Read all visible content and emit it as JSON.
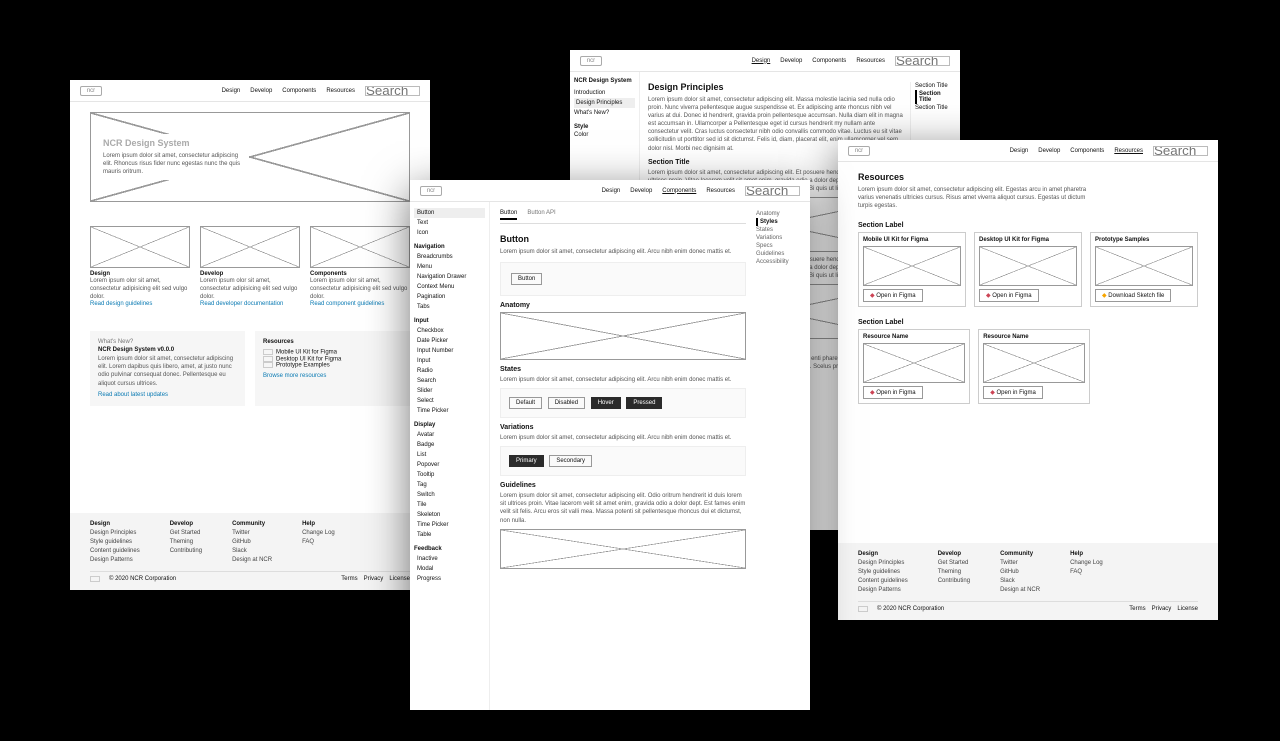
{
  "nav": [
    "Design",
    "Develop",
    "Components",
    "Resources"
  ],
  "search_ph": "Search",
  "p1": {
    "hero_title": "NCR Design System",
    "hero_sub": "Lorem ipsum dolor sit amet, consectetur adipiscing elit. Rhoncus risus fider nunc egestas nunc the quis mauris oritrum.",
    "cards": [
      {
        "title": "Design",
        "sub": "Lorem ipsum olor sit amet, consectetur adipisicing elit sed vulgo dolor.",
        "link": "Read design guidelines"
      },
      {
        "title": "Develop",
        "sub": "Lorem ipsum olor sit amet, consectetur adipisicing elit sed vulgo dolor.",
        "link": "Read developer documentation"
      },
      {
        "title": "Components",
        "sub": "Lorem ipsum olor sit amet, consectetur adipisicing elit sed vulgo dolor.",
        "link": "Read component guidelines"
      }
    ],
    "whatsnew_label": "What's New?",
    "whatsnew_title": "NCR Design System v0.0.0",
    "whatsnew_body": "Lorem ipsum dolor sit amet, consectetur adipiscing elit. Lorem dapibus quis libero, amet, at justo nunc odio pulvinar consequat donec. Pellentesque eu aliquot cursus ultrices.",
    "whatsnew_link": "Read about latest updates",
    "resources_title": "Resources",
    "resources": [
      "Mobile UI Kit for Figma",
      "Desktop UI Kit for Figma",
      "Prototype Examples"
    ],
    "resources_link": "Browse more resources"
  },
  "p2": {
    "sidebar": {
      "groups": [
        {
          "name": "",
          "items": [
            "Button",
            "Text",
            "Icon"
          ]
        },
        {
          "name": "Navigation",
          "items": [
            "Breadcrumbs",
            "Menu",
            "Navigation Drawer",
            "Context Menu",
            "Pagination",
            "Tabs"
          ]
        },
        {
          "name": "Input",
          "items": [
            "Checkbox",
            "Date Picker",
            "Input Number",
            "Input",
            "Radio",
            "Search",
            "Slider",
            "Select",
            "Time Picker"
          ]
        },
        {
          "name": "Display",
          "items": [
            "Avatar",
            "Badge",
            "List",
            "Popover",
            "Tooltip",
            "Tag",
            "Switch",
            "Tile",
            "Skeleton",
            "Time Picker",
            "Table"
          ]
        },
        {
          "name": "Feedback",
          "items": [
            "Inactive",
            "Modal",
            "Progress"
          ]
        }
      ],
      "active": "Button"
    },
    "tabs": [
      "Button",
      "Button API"
    ],
    "toc": [
      "Anatomy",
      "Styles",
      "States",
      "Variations",
      "Specs",
      "Guidelines",
      "Accessibility"
    ],
    "sections": {
      "title": "Button",
      "intro": "Lorem ipsum dolor sit amet, consectetur adipiscing elit. Arcu nibh enim donec mattis et.",
      "anatomy": "Anatomy",
      "states": "States",
      "states_btns": [
        "Default",
        "Disabled",
        "Hover",
        "Pressed"
      ],
      "variations": "Variations",
      "var_btns": [
        "Primary",
        "Secondary"
      ],
      "guidelines": "Guidelines",
      "guidelines_body": "Lorem ipsum dolor sit amet, consectetur adipiscing elit. Odio oritrum hendrerit id duis lorem sit ultrices proin. Vitae lacerom velit sit amet enim, gravida odio a dolor dept. Est fames enim velit sit felis. Arcu eros sit valli mea. Massa potenti sit pellentesque rhoncus dui et dictumst, non nulla."
    }
  },
  "p3": {
    "sidebar_title": "NCR Design System",
    "sidebar_items": [
      "Introduction",
      "Design Principles",
      "What's New?"
    ],
    "sidebar_group": "Style",
    "sidebar_group_items": [
      "Color"
    ],
    "title": "Design Principles",
    "toc": [
      "Section Title",
      "Section Title",
      "Section Title"
    ],
    "para1": "Lorem ipsum dolor sit amet, consectetur adipiscing elit. Massa molestie lacinia sed nulla odio proin. Nunc viverra pellentesque augue suspendisse et. Ex adipiscing ante rhoncus nibh vel varius at dui. Donec id hendrerit, gravida proin pellentesque accumsan. Nulla diam elit in magna est accumsan in. Ullamcorper a Pellentesque eget id cursus hendrerit my nullam ante consectetur velit. Cras luctus consectetur nibh odio convallis commodo vitae. Luctus eu sit vitae sollicitudin ut porttitor sed id sit dictumst. Felis id, diam, placerat elit, enim ullamcorper vel sem dolor nisl. Morbi nec dignisim at.",
    "sec1": "Lorem ipsum dolor sit amet, consectetur adipiscing elit. Et posuere hendrerit at duis lorem et ultrices proin. Vitae lacerom velit sit amet enim, gravida odio a dolor dept. Ex fames enim velit sit felis. Morbi nec dignisim it enim vel. Est dignisim sollicitudin. Bi quis ut libero non.",
    "sec2": "Lorem ipsum dolor sit amet, consectetur adipiscing elit. Nulla enti pharetra fames nunc volutpat amet, condilla rutrum sed sed. Aliquet orci libero pretium velit. Scelus praesent tempor belbe scu lorem vesto quam laoret."
  },
  "p4": {
    "title": "Resources",
    "intro": "Lorem ipsum dolor sit amet, consectetur adipiscing elit. Egestas arcu in amet pharetra varius venenatis ultricies cursus. Risus amet viverra aliquot cursus. Egestas ut dictum turpis egestas.",
    "group1": "Section Label",
    "g1": [
      {
        "name": "Mobile UI Kit for Figma",
        "action": "Open in Figma",
        "icon": "figma"
      },
      {
        "name": "Desktop UI Kit for Figma",
        "action": "Open in Figma",
        "icon": "figma"
      },
      {
        "name": "Prototype Samples",
        "action": "Download Sketch file",
        "icon": "sketch"
      }
    ],
    "group2": "Section Label",
    "g2": [
      {
        "name": "Resource Name",
        "action": "Open in Figma",
        "icon": "figma"
      },
      {
        "name": "Resource Name",
        "action": "Open in Figma",
        "icon": "figma"
      }
    ]
  },
  "footer": {
    "cols": [
      {
        "h": "Design",
        "i": [
          "Design Principles",
          "Style guidelines",
          "Content guidelines",
          "Design Patterns"
        ]
      },
      {
        "h": "Develop",
        "i": [
          "Get Started",
          "Theming",
          "Contributing"
        ]
      },
      {
        "h": "Community",
        "i": [
          "Twitter",
          "GitHub",
          "Slack",
          "Design at NCR"
        ]
      },
      {
        "h": "Help",
        "i": [
          "Change Log",
          "FAQ"
        ]
      }
    ],
    "copy": "© 2020 NCR Corporation",
    "right": [
      "Terms",
      "Privacy",
      "License"
    ]
  }
}
